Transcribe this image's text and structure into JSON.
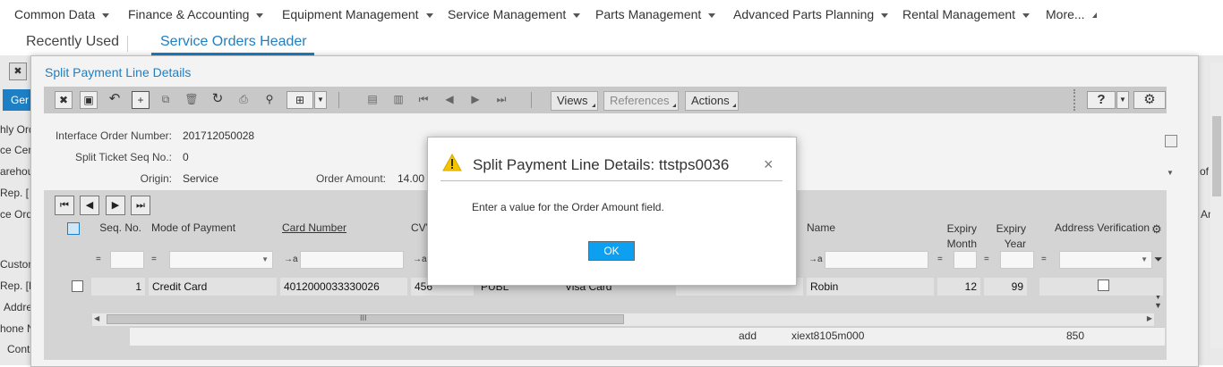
{
  "menu": {
    "items": [
      "Common Data",
      "Finance & Accounting",
      "Equipment Management",
      "Service Management",
      "Parts Management",
      "Advanced Parts Planning",
      "Rental Management",
      "More..."
    ]
  },
  "tabs": {
    "recently_used": "Recently Used",
    "active": "Service Orders Header"
  },
  "background": {
    "tab_fragment": "Ger",
    "left_labels": [
      "hly Ord",
      "ce Cen",
      "arehou",
      "Rep. [",
      "ce Ord",
      "Custom",
      "Rep. [E",
      "Addre",
      "hone N",
      "Cont"
    ],
    "right_labels": [
      "o of",
      "t An"
    ],
    "row": {
      "c1": "add",
      "c2": "xiext8105m000",
      "c3": "850"
    }
  },
  "split_dialog": {
    "title": "Split Payment Line Details",
    "toolbar": {
      "views": "Views",
      "references": "References",
      "actions": "Actions",
      "help": "?"
    },
    "form": {
      "interface_order_label": "Interface Order Number:",
      "interface_order_value": "201712050028",
      "split_ticket_label": "Split Ticket Seq No.:",
      "split_ticket_value": "0",
      "origin_label": "Origin:",
      "origin_value": "Service",
      "order_amount_label": "Order Amount:",
      "order_amount_value": "14.00"
    },
    "grid": {
      "columns": {
        "seq_no": "Seq. No.",
        "mode_of_payment": "Mode of Payment",
        "card_number": "Card Number",
        "cvv": "CVV",
        "name": "Name",
        "expiry_month_1": "Expiry",
        "expiry_month_2": "Month",
        "expiry_year_1": "Expiry",
        "expiry_year_2": "Year",
        "address_verification": "Address Verification"
      },
      "row": {
        "seq_no": "1",
        "mode_of_payment": "Credit Card",
        "card_number": "4012000033330026",
        "cvv": "456",
        "code": "PUBL",
        "card_type": "Visa Card",
        "name": "Robin",
        "expiry_month": "12",
        "expiry_year": "99"
      },
      "scroll_grip": "III"
    }
  },
  "modal": {
    "title": "Split Payment Line Details: ttstps0036",
    "message": "Enter a value for the Order Amount field.",
    "ok_label": "OK",
    "close_glyph": "×"
  },
  "colors": {
    "accent": "#1e7fc4",
    "ok_button": "#0ea0f0",
    "warning": "#f5c400"
  }
}
